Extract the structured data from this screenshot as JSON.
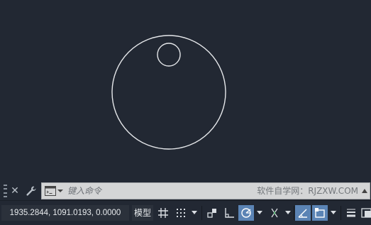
{
  "drawing": {
    "shapes": [
      {
        "type": "circle",
        "label": "large-circle"
      },
      {
        "type": "circle",
        "label": "small-circle"
      }
    ]
  },
  "command_line": {
    "placeholder": "键入命令",
    "watermark": "软件自学网：RJZXW.COM"
  },
  "status_bar": {
    "coordinates": "1935.2844, 1091.0193, 0.0000",
    "model_label": "模型",
    "active_toggles": [
      "polar-tracking",
      "dynamic-ucs",
      "dynamic-input"
    ]
  },
  "colors": {
    "canvas_bg": "#222833",
    "stroke": "#e6e8eb",
    "active_toggle": "#5b84b5",
    "command_input_bg": "#d4d5d6"
  }
}
